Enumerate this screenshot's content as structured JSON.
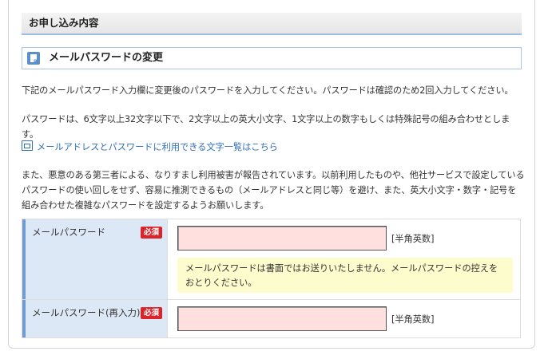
{
  "section": {
    "title": "お申し込み内容"
  },
  "subsection": {
    "icon": "document-icon",
    "title": "メールパスワードの変更"
  },
  "instructions": {
    "p1": "下記のメールパスワード入力欄に変更後のパスワードを入力してください。パスワードは確認のため2回入力してください。",
    "p2": "パスワードは、6文字以上32文字以下で、2文字以上の英大小文字、1文字以上の数字もしくは特殊記号の組み合わせとします。",
    "link": "メールアドレスとパスワードに利用できる文字一覧はこちら",
    "p3": "また、悪意のある第三者による、なりすまし利用被害が報告されています。以前利用したものや、他社サービスで設定しているパスワードの使い回しをせず、容易に推測できるもの（メールアドレスと同じ等）を避け、また、英大小文字・数字・記号を組み合わせた複雑なパスワードを設定するようお願いします。"
  },
  "form": {
    "password": {
      "label": "メールパスワード",
      "required": "必須",
      "value": "",
      "hint": "[半角英数]",
      "note": "メールパスワードは書面ではお送りいたしません。メールパスワードの控えをおとりください。"
    },
    "password_confirm": {
      "label": "メールパスワード(再入力)",
      "required": "必須",
      "value": "",
      "hint": "[半角英数]"
    }
  },
  "colors": {
    "accent": "#6f9bd1",
    "required_badge": "#d9242a",
    "input_bg": "#ffe0df",
    "note_bg": "#fdfccc",
    "link": "#2f6fb7"
  }
}
